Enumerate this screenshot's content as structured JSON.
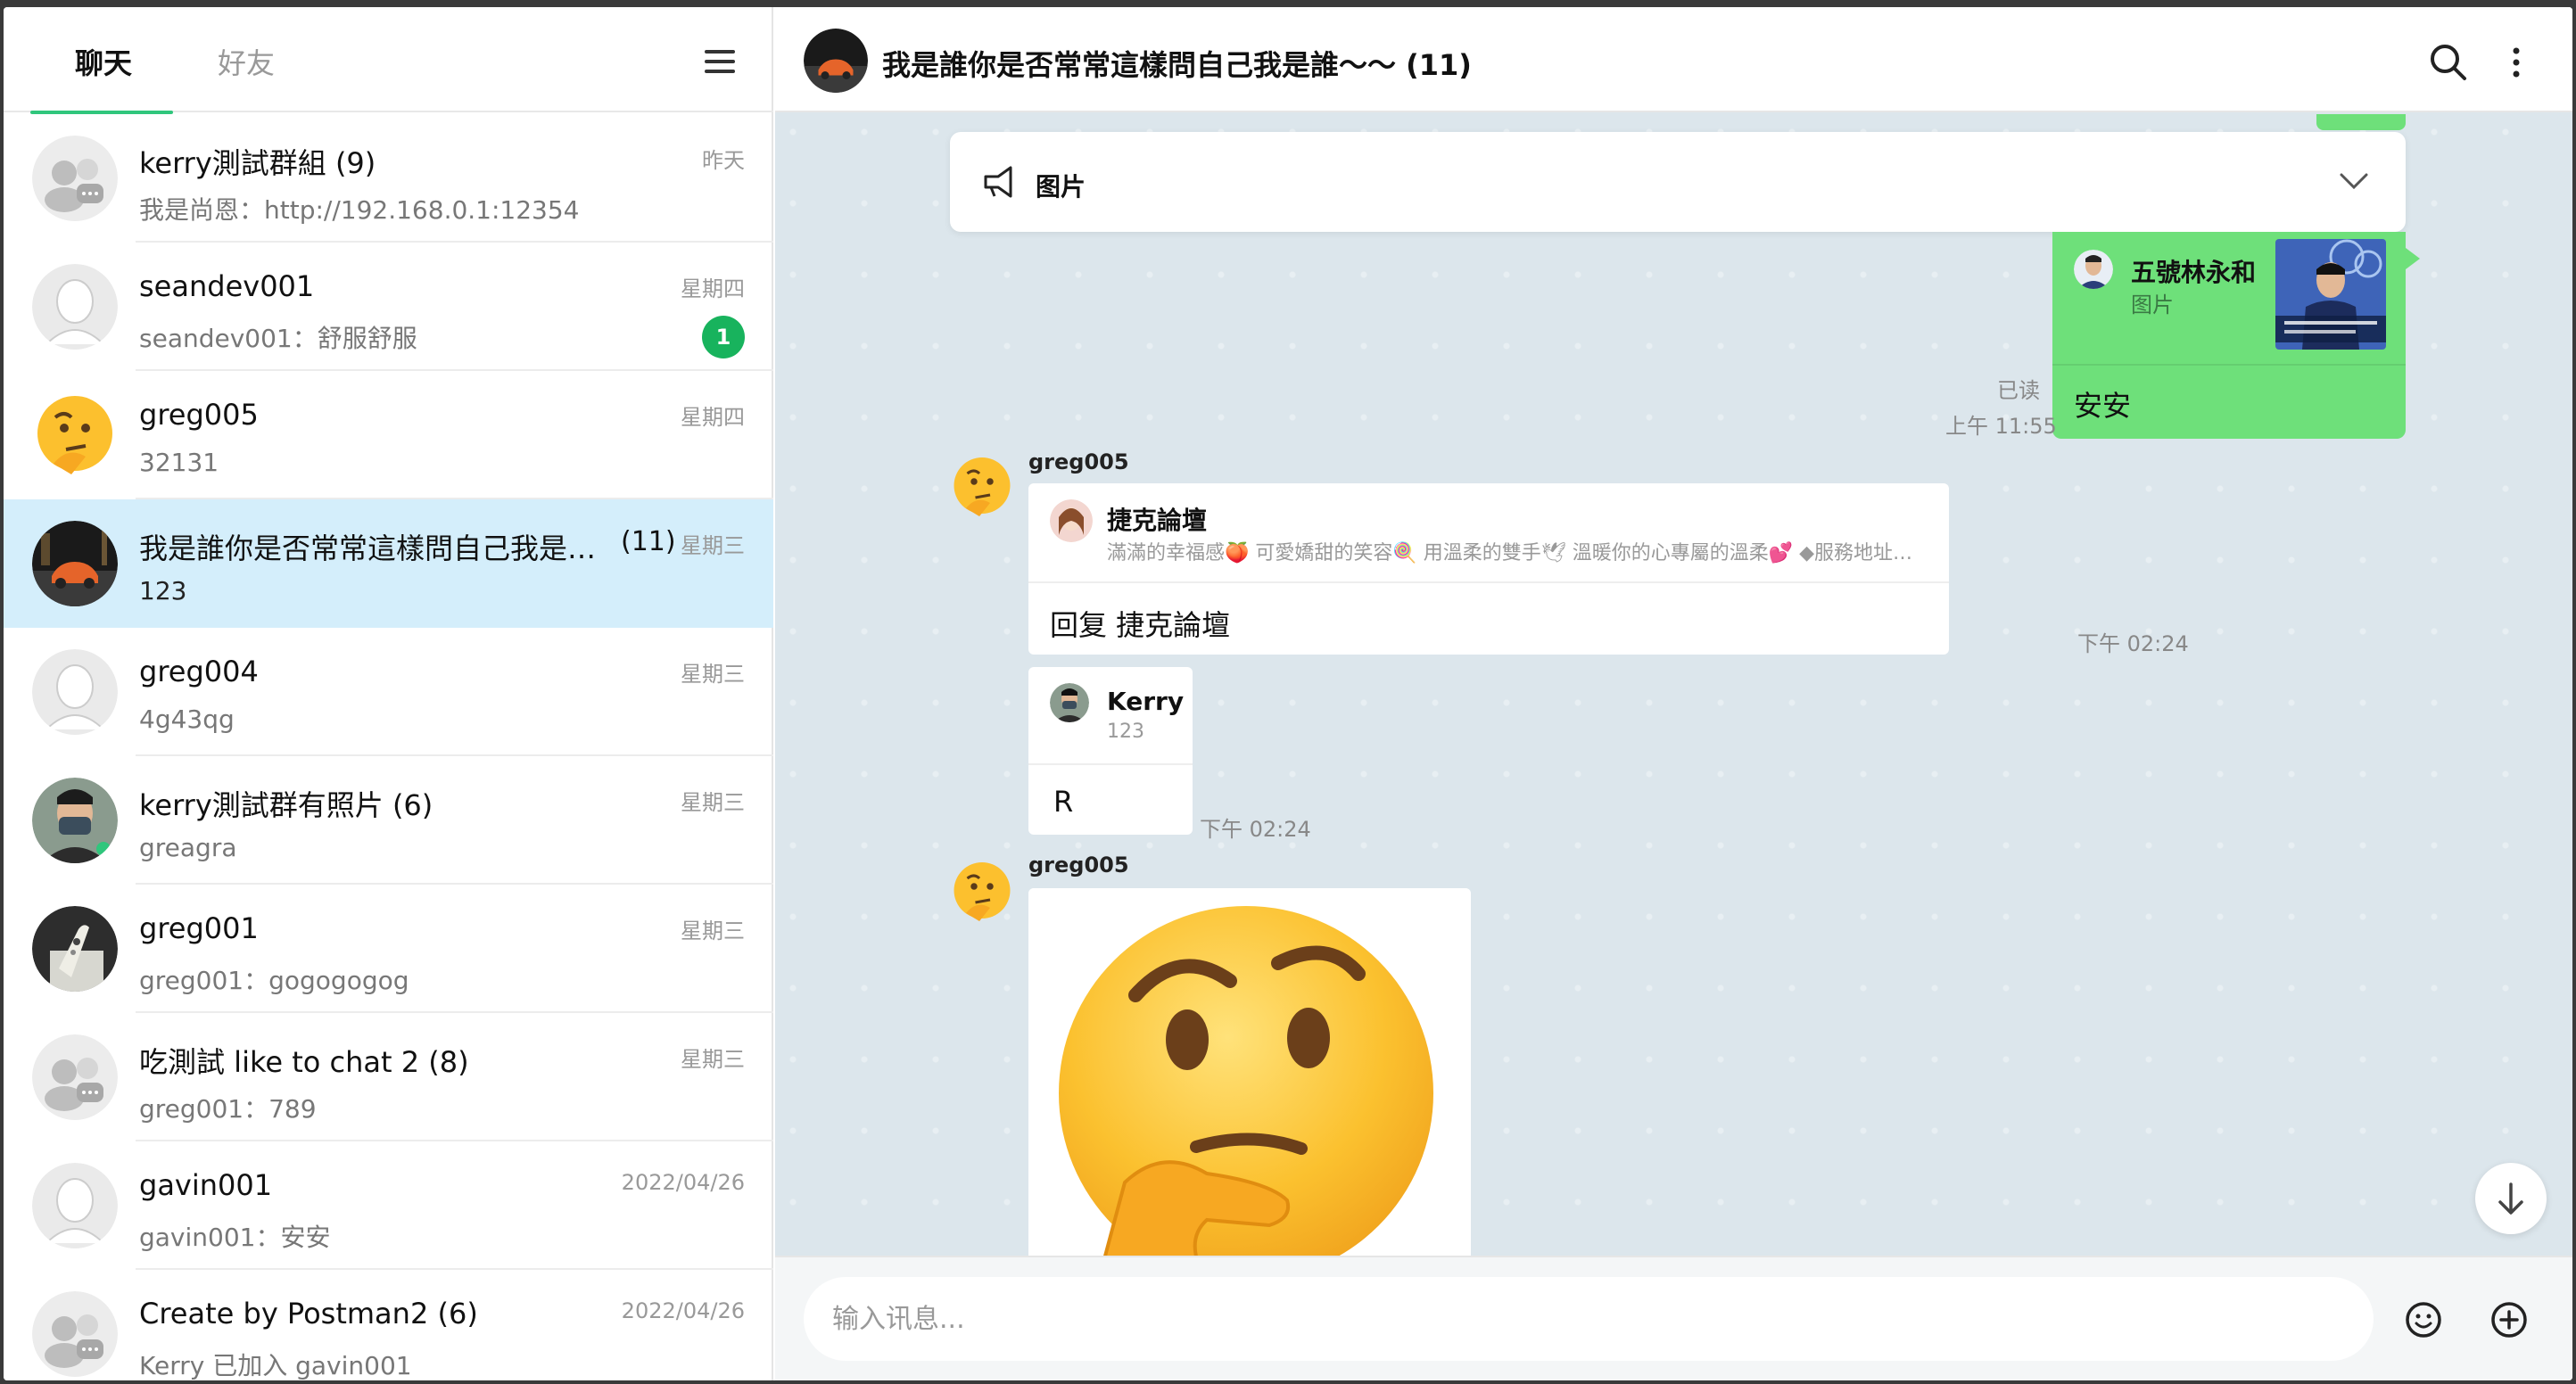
{
  "sidebar": {
    "tabs": [
      {
        "label": "聊天",
        "active": true
      },
      {
        "label": "好友",
        "active": false
      }
    ],
    "chats": [
      {
        "name": "kerry測試群組 (9)",
        "count": "",
        "preview": "我是尚恩：http://192.168.0.1:12354",
        "time": "昨天",
        "unread": "",
        "avatar": "group"
      },
      {
        "name": "seandev001",
        "count": "",
        "preview": "seandev001：舒服舒服",
        "time": "星期四",
        "unread": "1",
        "avatar": "person"
      },
      {
        "name": "greg005",
        "count": "",
        "preview": "32131",
        "time": "星期四",
        "unread": "",
        "avatar": "thinking-emoji"
      },
      {
        "name": "我是誰你是否常常這樣問自己我是…",
        "count": "(11)",
        "preview": "123",
        "time": "星期三",
        "unread": "",
        "avatar": "car-photo",
        "active": true
      },
      {
        "name": "greg004",
        "count": "",
        "preview": "4g43qg",
        "time": "星期三",
        "unread": "",
        "avatar": "person"
      },
      {
        "name": "kerry測試群有照片 (6)",
        "count": "",
        "preview": "greagra",
        "time": "星期三",
        "unread": "",
        "avatar": "masked-person-photo"
      },
      {
        "name": "greg001",
        "count": "",
        "preview": "greg001：gogogogog",
        "time": "星期三",
        "unread": "",
        "avatar": "remote-photo"
      },
      {
        "name": "吃測試 like to chat 2 (8)",
        "count": "",
        "preview": "greg001：789",
        "time": "星期三",
        "unread": "",
        "avatar": "group"
      },
      {
        "name": "gavin001",
        "count": "",
        "preview": "gavin001：安安",
        "time": "2022/04/26",
        "unread": "",
        "avatar": "person"
      },
      {
        "name": "Create by Postman2 (6)",
        "count": "",
        "preview": "Kerry 已加入 gavin001",
        "time": "2022/04/26",
        "unread": "",
        "avatar": "group"
      }
    ]
  },
  "header": {
    "title": "我是誰你是否常常這樣問自己我是誰～～ (11)"
  },
  "pinned": {
    "label": "图片"
  },
  "messages": {
    "outgoing": {
      "reply_name": "五號林永和",
      "reply_sub": "图片",
      "text": "安安",
      "read": "已读",
      "time": "上午 11:55"
    },
    "incoming1": {
      "sender": "greg005",
      "card_name": "捷克論壇",
      "card_desc": "滿滿的幸福感🍑 可愛嬌甜的笑容🍭 用溫柔的雙手🕊 溫暖你的心專屬的溫柔💕 ◆服務地址：新生…",
      "text": "回复 捷克論壇",
      "time": "下午 02:24"
    },
    "incoming2": {
      "card_name": "Kerry",
      "card_sub": "123",
      "text": "R",
      "time": "下午 02:24"
    },
    "incoming3": {
      "sender": "greg005"
    }
  },
  "composer": {
    "placeholder": "输入讯息..."
  },
  "colors": {
    "accent": "#30c67c",
    "outgoing_bubble": "#6ee07a",
    "active_row": "#d4eefb",
    "chat_bg": "#dce6ec",
    "unread_badge": "#18b35d"
  }
}
